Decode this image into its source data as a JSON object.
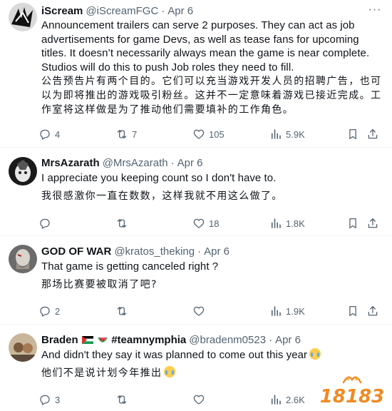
{
  "tweets": [
    {
      "name": "iScream",
      "handle": "@iScreamFGC",
      "sep": "·",
      "date": "Apr 6",
      "text_en": "Announcement trailers can serve 2 purposes. They can act as job advertisements for game Devs, as well as tease fans for upcoming titles. It doesn’t necessarily always mean the game is near complete. Studios will do this to push Job roles they need to fill.",
      "text_zh": "公告预告片有两个目的。它们可以充当游戏开发人员的招聘广告，也可以为即将推出的游戏吸引粉丝。这并不一定意味着游戏已接近完成。工作室将这样做是为了推动他们需要填补的工作角色。",
      "replies": "4",
      "retweets": "7",
      "likes": "105",
      "views": "5.9K"
    },
    {
      "name": "MrsAzarath",
      "handle": "@MrsAzarath",
      "sep": "·",
      "date": "Apr 6",
      "text_en": "I appreciate you keeping count so I don't have to.",
      "text_zh": "我很感激你一直在数数，这样我就不用这么做了。",
      "replies": "",
      "retweets": "",
      "likes": "18",
      "views": "1.8K"
    },
    {
      "name": "GOD OF WAR",
      "handle": "@kratos_theking",
      "sep": "·",
      "date": "Apr 6",
      "text_en": "That game is getting canceled right ?",
      "text_zh": "那场比赛要被取消了吧?",
      "replies": "2",
      "retweets": "",
      "likes": "",
      "views": "1.9K"
    },
    {
      "name_prefix": "Braden",
      "name_suffix": "#teamnymphia",
      "handle": "@bradenm0523",
      "sep": "·",
      "date": "Apr 6",
      "text_en": "And didn't they say it was planned to come out this year",
      "text_zh": "他们不是说计划今年推出",
      "replies": "3",
      "retweets": "",
      "likes": "",
      "views": "2.6K"
    }
  ],
  "icons": {
    "reply": "reply-icon",
    "retweet": "retweet-icon",
    "like": "heart-icon",
    "views": "views-chart-icon",
    "bookmark": "bookmark-icon",
    "share": "share-icon",
    "more": "more-dots-icon"
  },
  "watermark": {
    "logo_text": "18183"
  },
  "colors": {
    "text": "#0f1419",
    "secondary": "#536471",
    "divider": "#eff3f4",
    "watermark_orange": "#f08a24"
  }
}
